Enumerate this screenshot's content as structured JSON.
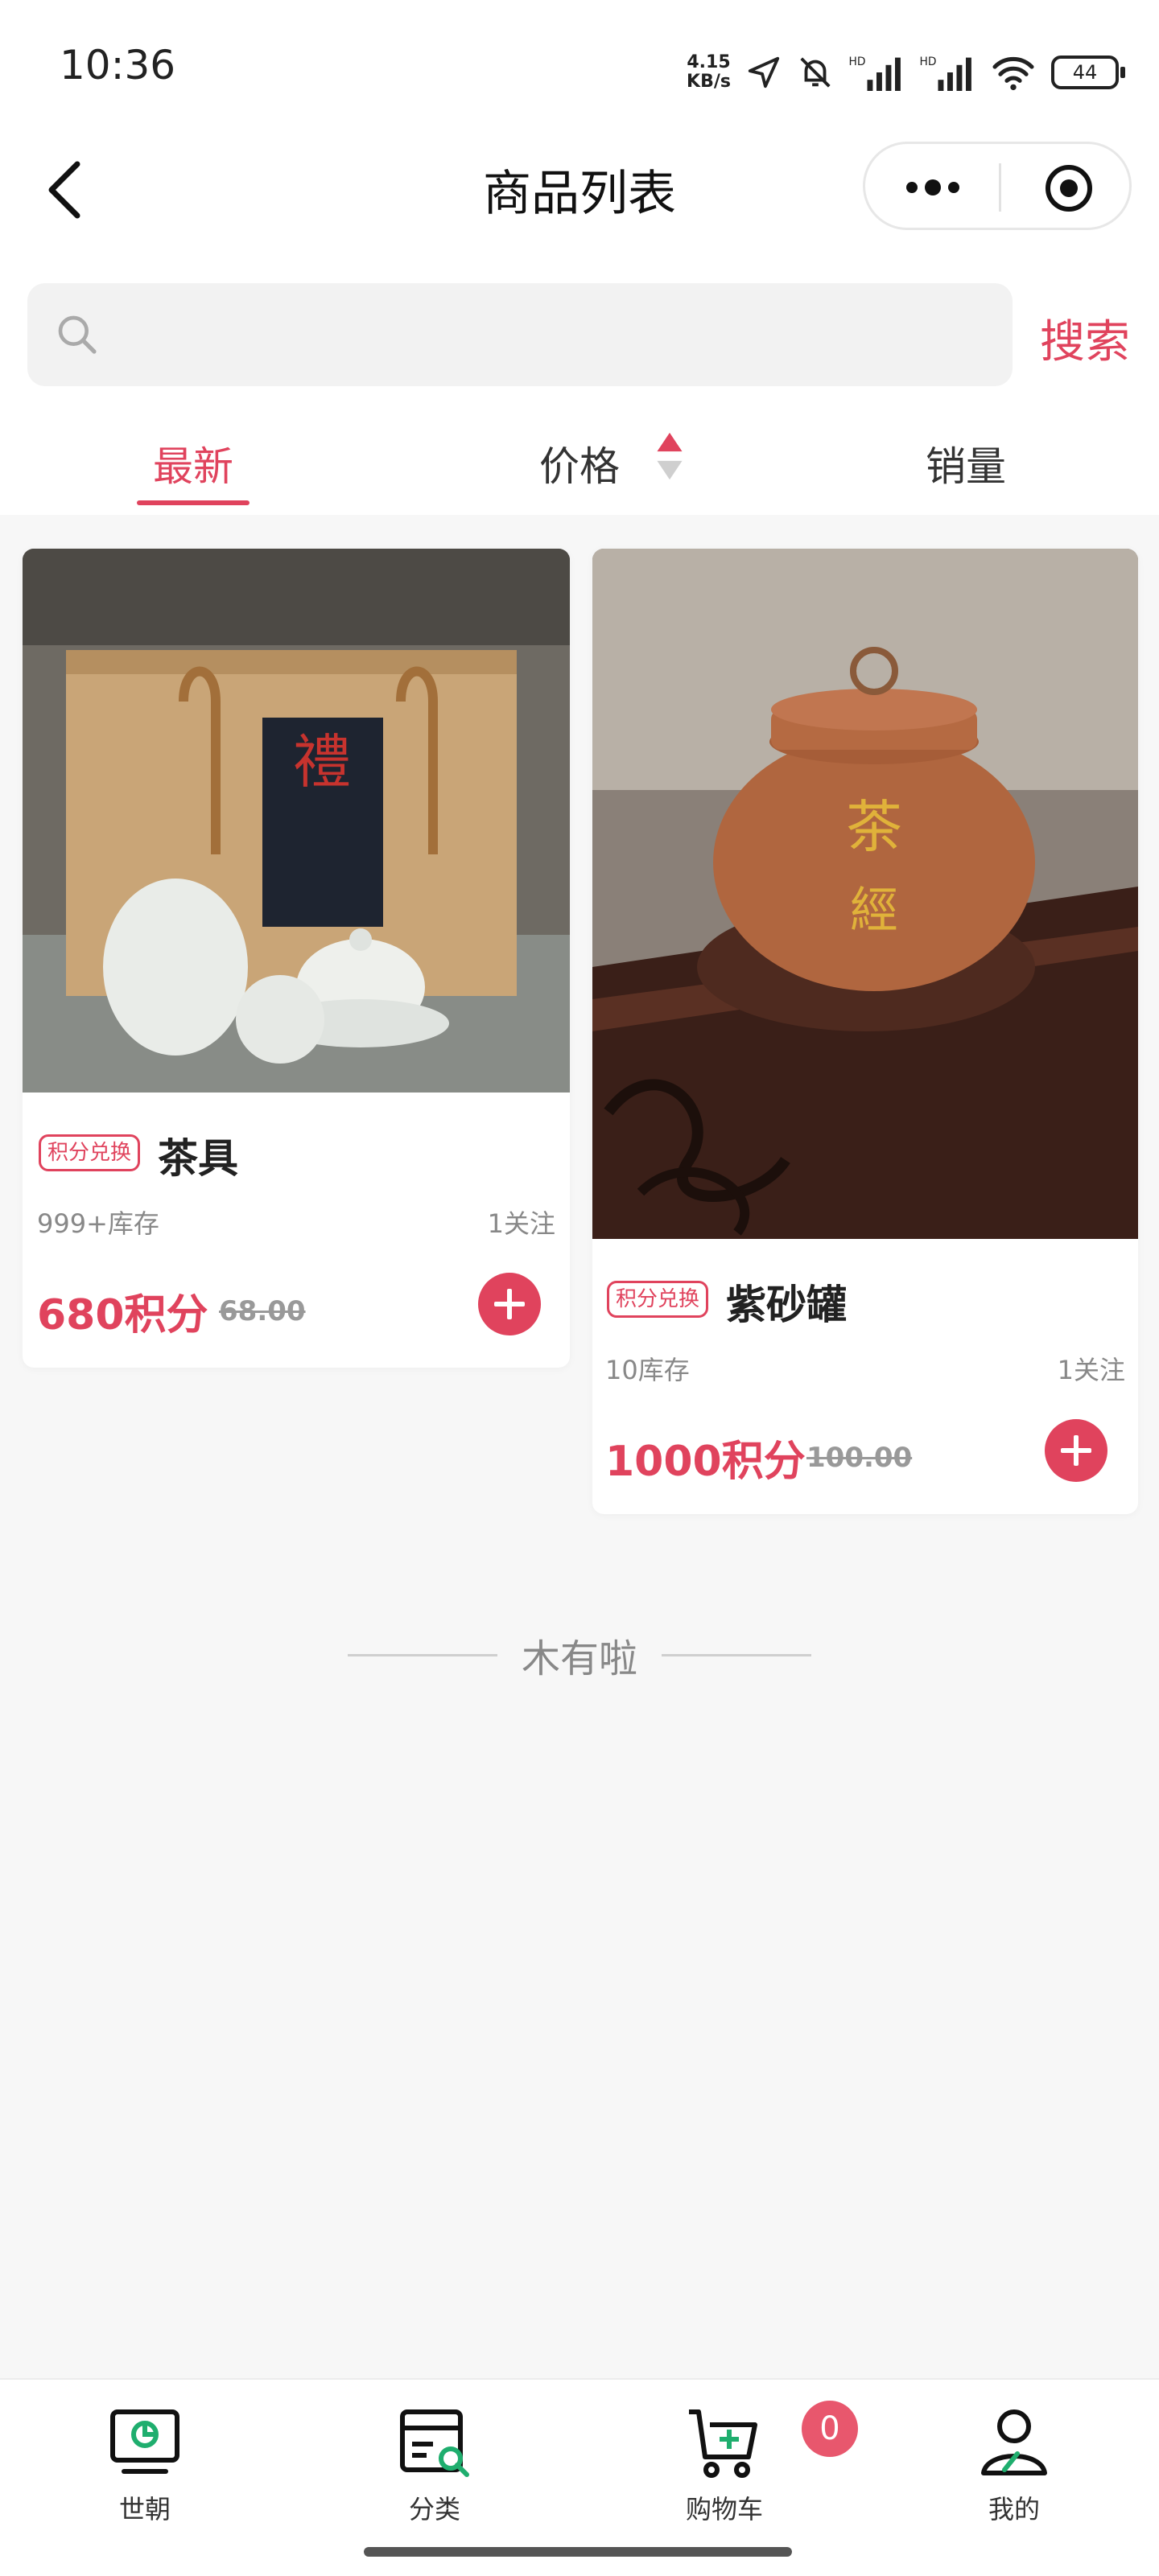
{
  "status_bar": {
    "time": "10:36",
    "net_speed_value": "4.15",
    "net_speed_unit": "KB/s",
    "battery": "44"
  },
  "header": {
    "title": "商品列表"
  },
  "search": {
    "placeholder": "",
    "button_label": "搜索"
  },
  "sort_tabs": [
    {
      "label": "最新",
      "active": true
    },
    {
      "label": "价格",
      "active": false
    },
    {
      "label": "销量",
      "active": false
    }
  ],
  "products": [
    {
      "badge": "积分兑换",
      "name": "茶具",
      "stock": "999+库存",
      "follows": "1关注",
      "points": "680积分",
      "original_price": "68.00"
    },
    {
      "badge": "积分兑换",
      "name": "紫砂罐",
      "stock": "10库存",
      "follows": "1关注",
      "points": "1000积分",
      "original_price": "100.00"
    }
  ],
  "list_end_text": "木有啦",
  "bottom_nav": [
    {
      "label": "世朝",
      "icon": "home-monitor-icon"
    },
    {
      "label": "分类",
      "icon": "category-search-icon"
    },
    {
      "label": "购物车",
      "icon": "cart-icon",
      "badge": "0"
    },
    {
      "label": "我的",
      "icon": "user-icon"
    }
  ],
  "colors": {
    "accent": "#e0435d",
    "nav_icon_green": "#1fae6e"
  }
}
